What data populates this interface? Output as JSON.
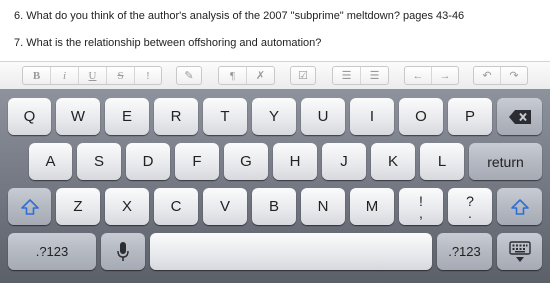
{
  "document": {
    "lines": [
      "6. What do you think of the author's analysis of the 2007 \"subprime\" meltdown? pages 43-46",
      "7. What is the relationship between offshoring and automation?"
    ]
  },
  "toolbar": {
    "groups": [
      {
        "name": "text-style",
        "buttons": [
          {
            "name": "bold-button",
            "label": "B",
            "icon": "bold-icon"
          },
          {
            "name": "italic-button",
            "label": "i",
            "icon": "italic-icon"
          },
          {
            "name": "underline-button",
            "label": "U",
            "icon": "underline-icon"
          },
          {
            "name": "strikethrough-button",
            "label": "S",
            "icon": "strikethrough-icon"
          },
          {
            "name": "more-button",
            "label": "!",
            "icon": "exclamation-icon"
          }
        ]
      },
      {
        "name": "edit",
        "buttons": [
          {
            "name": "edit-link-button",
            "label": "✎",
            "icon": "edit-icon"
          }
        ]
      },
      {
        "name": "paragraph",
        "buttons": [
          {
            "name": "paragraph-button",
            "label": "¶",
            "icon": "pilcrow-icon"
          },
          {
            "name": "clear-format-button",
            "label": "✗",
            "icon": "clear-format-icon"
          }
        ]
      },
      {
        "name": "check",
        "buttons": [
          {
            "name": "checkbox-button",
            "label": "☑",
            "icon": "checkbox-icon"
          }
        ]
      },
      {
        "name": "lists",
        "buttons": [
          {
            "name": "bullet-list-button",
            "label": "☰",
            "icon": "bullet-list-icon"
          },
          {
            "name": "numbered-list-button",
            "label": "☰",
            "icon": "numbered-list-icon"
          }
        ]
      },
      {
        "name": "indent",
        "buttons": [
          {
            "name": "outdent-button",
            "label": "←",
            "icon": "left-arrow-icon"
          },
          {
            "name": "indent-button",
            "label": "→",
            "icon": "right-arrow-icon"
          }
        ]
      },
      {
        "name": "history",
        "buttons": [
          {
            "name": "undo-button",
            "label": "↶",
            "icon": "undo-icon"
          },
          {
            "name": "redo-button",
            "label": "↷",
            "icon": "redo-icon"
          }
        ]
      }
    ]
  },
  "keyboard": {
    "row1": [
      "Q",
      "W",
      "E",
      "R",
      "T",
      "Y",
      "U",
      "I",
      "O",
      "P"
    ],
    "row2": [
      "A",
      "S",
      "D",
      "F",
      "G",
      "H",
      "J",
      "K",
      "L"
    ],
    "return_label": "return",
    "row3": [
      "Z",
      "X",
      "C",
      "V",
      "B",
      "N",
      "M"
    ],
    "punct1": {
      "top": "!",
      "bottom": ","
    },
    "punct2": {
      "top": "?",
      "bottom": "."
    },
    "numbers_label": ".?123",
    "icons": {
      "shift": "shift-icon",
      "backspace": "backspace-icon",
      "mic": "microphone-icon",
      "hide": "keyboard-hide-icon"
    }
  }
}
